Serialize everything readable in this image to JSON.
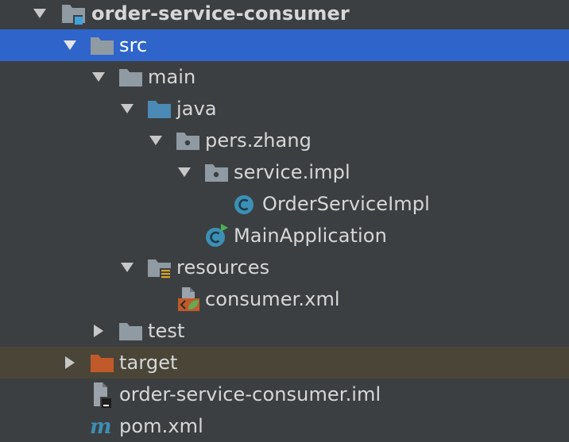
{
  "project_tree": {
    "root": {
      "label": "order-service-consumer",
      "icon": "module-folder-icon",
      "expanded": true
    },
    "src": {
      "label": "src",
      "icon": "folder-icon",
      "expanded": true,
      "selected": true
    },
    "main": {
      "label": "main",
      "icon": "folder-icon",
      "expanded": true
    },
    "java": {
      "label": "java",
      "icon": "source-root-folder-icon",
      "expanded": true
    },
    "pers_zhang": {
      "label": "pers.zhang",
      "icon": "package-icon",
      "expanded": true
    },
    "service_impl": {
      "label": "service.impl",
      "icon": "package-icon",
      "expanded": true
    },
    "order_service_impl": {
      "label": "OrderServiceImpl",
      "icon": "java-class-icon"
    },
    "main_application": {
      "label": "MainApplication",
      "icon": "java-main-class-icon"
    },
    "resources": {
      "label": "resources",
      "icon": "resources-root-folder-icon",
      "expanded": true
    },
    "consumer_xml": {
      "label": "consumer.xml",
      "icon": "spring-xml-icon"
    },
    "test": {
      "label": "test",
      "icon": "folder-icon",
      "expanded": false
    },
    "target": {
      "label": "target",
      "icon": "excluded-folder-icon",
      "expanded": false,
      "excluded": true
    },
    "iml_file": {
      "label": "order-service-consumer.iml",
      "icon": "iml-file-icon"
    },
    "pom_xml": {
      "label": "pom.xml",
      "icon": "maven-pom-icon"
    }
  },
  "colors": {
    "background": "#3c3f41",
    "selection": "#2f65ca",
    "excluded_row": "#4b4538",
    "text": "#d7d7d7",
    "folder": "#8f9aa3",
    "source_folder": "#4a8ab5",
    "excluded_folder": "#c05a2a",
    "class_icon": "#3d8fb5"
  }
}
